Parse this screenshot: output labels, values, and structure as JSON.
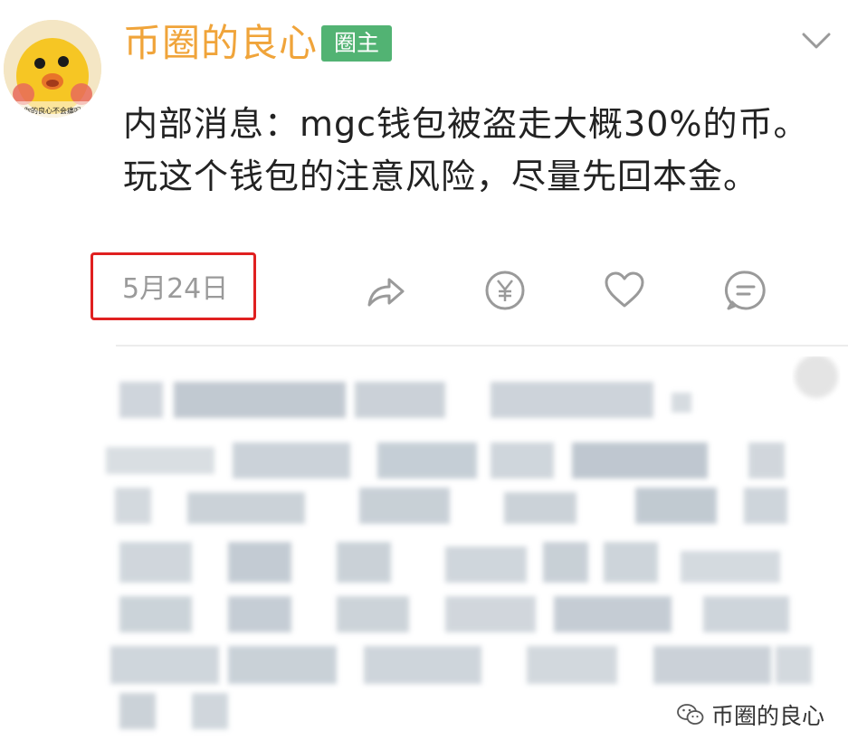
{
  "post": {
    "author": {
      "name": "币圈的良心",
      "badge": "圈主",
      "avatar_caption": "你的良心不会痛吗"
    },
    "content": "内部消息：mgc钱包被盗走大概30%的币。玩这个钱包的注意风险，尽量先回本金。",
    "date": "5月24日"
  },
  "actions": [
    {
      "icon": "share-icon"
    },
    {
      "icon": "yen-reward-icon"
    },
    {
      "icon": "heart-icon"
    },
    {
      "icon": "comment-icon"
    }
  ],
  "header": {
    "more_icon": "chevron-down-icon"
  },
  "comments": {
    "state": "blurred"
  },
  "watermark": {
    "icon": "wechat-icon",
    "text": "币圈的良心"
  },
  "colors": {
    "username": "#f0a43a",
    "badge": "#52b373",
    "highlight_box": "#e02020",
    "icon_gray": "#9a9a9a"
  }
}
